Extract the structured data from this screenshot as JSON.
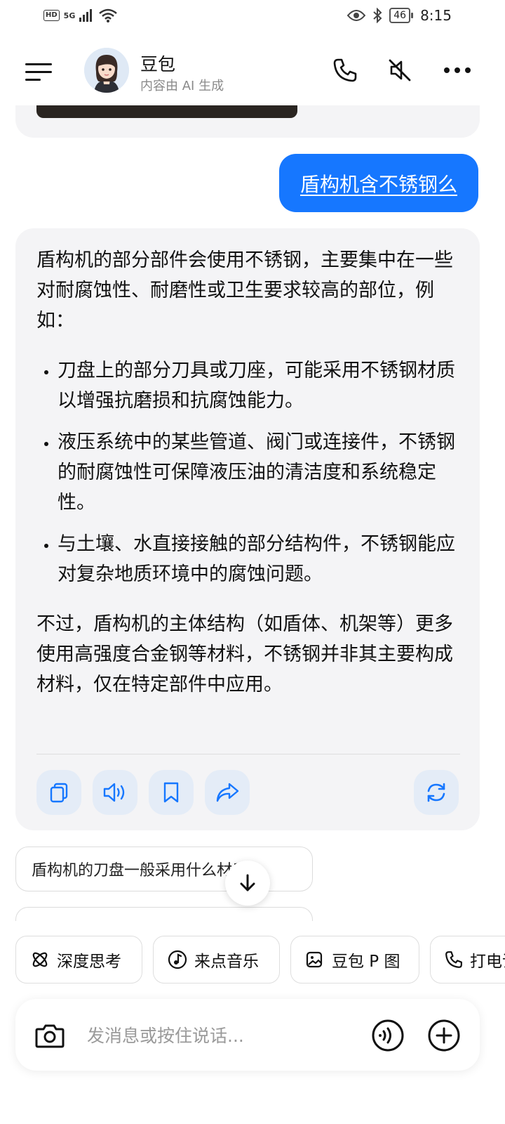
{
  "status_bar": {
    "left_badge": "HD",
    "network": "5G",
    "battery": "46",
    "time": "8:15"
  },
  "header": {
    "title": "豆包",
    "subtitle": "内容由 AI 生成"
  },
  "chat": {
    "user_message": "盾构机含不锈钢么",
    "ai_intro": "盾构机的部分部件会使用不锈钢，主要集中在一些对耐腐蚀性、耐磨性或卫生要求较高的部位，例如：",
    "ai_bullets": [
      "刀盘上的部分刀具或刀座，可能采用不锈钢材质以增强抗磨损和抗腐蚀能力。",
      "液压系统中的某些管道、阀门或连接件，不锈钢的耐腐蚀性可保障液压油的清洁度和系统稳定性。",
      "与土壤、水直接接触的部分结构件，不锈钢能应对复杂地质环境中的腐蚀问题。"
    ],
    "ai_outro": "不过，盾构机的主体结构（如盾体、机架等）更多使用高强度合金钢等材料，不锈钢并非其主要构成材料，仅在特定部件中应用。"
  },
  "suggestions": [
    "盾构机的刀盘一般采用什么材质？"
  ],
  "quick_actions": [
    {
      "label": "深度思考",
      "icon": "atom-icon"
    },
    {
      "label": "来点音乐",
      "icon": "music-note-icon"
    },
    {
      "label": "豆包 P 图",
      "icon": "image-edit-icon"
    },
    {
      "label": "打电话",
      "icon": "phone-icon"
    }
  ],
  "input": {
    "placeholder": "发消息或按住说话..."
  },
  "colors": {
    "accent": "#1677ff",
    "bubble_bg": "#f4f4f6",
    "action_bg": "#e4ecf7"
  }
}
